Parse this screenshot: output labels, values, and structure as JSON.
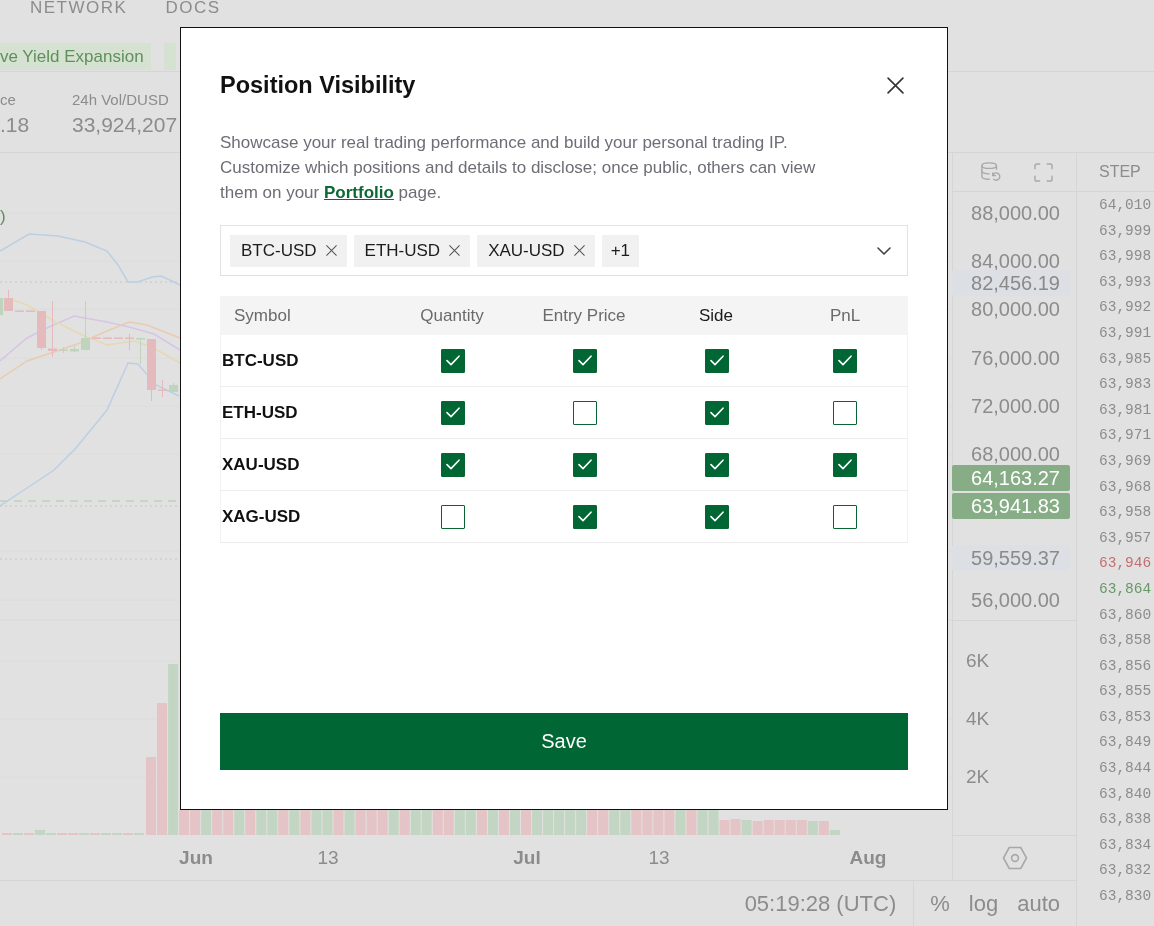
{
  "nav": {
    "items": [
      {
        "label": "NETWORK"
      },
      {
        "label": "DOCS"
      }
    ]
  },
  "announcements": [
    {
      "label": "ve Yield Expansion"
    }
  ],
  "market_stats": [
    {
      "label": "ce",
      "value": ".18"
    },
    {
      "label": "24h Vol/DUSD",
      "value": "33,924,207"
    }
  ],
  "chart": {
    "legend": ")",
    "time_axis": [
      {
        "label": "Jun",
        "kind": "month"
      },
      {
        "label": "13",
        "kind": "day"
      },
      {
        "label": "Jul",
        "kind": "month"
      },
      {
        "label": "13",
        "kind": "day"
      },
      {
        "label": "Aug",
        "kind": "month"
      }
    ]
  },
  "price_axis": {
    "labels": [
      {
        "text": "88,000.00",
        "kind": "tick"
      },
      {
        "text": "84,000.00",
        "kind": "tick"
      },
      {
        "text": "82,456.19",
        "kind": "marker",
        "color": "#dcdfe3"
      },
      {
        "text": "80,000.00",
        "kind": "tick"
      },
      {
        "text": "76,000.00",
        "kind": "tick"
      },
      {
        "text": "72,000.00",
        "kind": "tick"
      },
      {
        "text": "68,000.00",
        "kind": "tick"
      },
      {
        "text": "64,163.27",
        "kind": "marker",
        "color": "#86ad86"
      },
      {
        "text": "63,941.83",
        "kind": "marker",
        "color": "#86ad86"
      },
      {
        "text": "59,559.37",
        "kind": "marker",
        "color": "#dcdfe3"
      },
      {
        "text": "56,000.00",
        "kind": "tick"
      }
    ],
    "volume_labels": [
      "6K",
      "4K",
      "2K"
    ]
  },
  "bottom_bar": {
    "time": "05:19:28 (UTC)",
    "toggles": [
      {
        "label": "%"
      },
      {
        "label": "log"
      },
      {
        "label": "auto"
      }
    ]
  },
  "order_book": {
    "header": "STEP",
    "rows": [
      {
        "price": "64,010",
        "color": "#8c8c8c"
      },
      {
        "price": "63,999",
        "color": "#8c8c8c"
      },
      {
        "price": "63,998",
        "color": "#8c8c8c"
      },
      {
        "price": "63,993",
        "color": "#8c8c8c"
      },
      {
        "price": "63,992",
        "color": "#8c8c8c"
      },
      {
        "price": "63,991",
        "color": "#8c8c8c"
      },
      {
        "price": "63,985",
        "color": "#8c8c8c"
      },
      {
        "price": "63,983",
        "color": "#8c8c8c"
      },
      {
        "price": "63,981",
        "color": "#8c8c8c"
      },
      {
        "price": "63,971",
        "color": "#8c8c8c"
      },
      {
        "price": "63,969",
        "color": "#8c8c8c"
      },
      {
        "price": "63,968",
        "color": "#8c8c8c"
      },
      {
        "price": "63,958",
        "color": "#8c8c8c"
      },
      {
        "price": "63,957",
        "color": "#8c8c8c"
      },
      {
        "price": "63,946",
        "color": "#c46f6f"
      },
      {
        "price": "63,864",
        "color": "#669966"
      },
      {
        "price": "63,860",
        "color": "#8c8c8c"
      },
      {
        "price": "63,858",
        "color": "#8c8c8c"
      },
      {
        "price": "63,856",
        "color": "#8c8c8c"
      },
      {
        "price": "63,855",
        "color": "#8c8c8c"
      },
      {
        "price": "63,853",
        "color": "#8c8c8c"
      },
      {
        "price": "63,849",
        "color": "#8c8c8c"
      },
      {
        "price": "63,844",
        "color": "#8c8c8c"
      },
      {
        "price": "63,840",
        "color": "#8c8c8c"
      },
      {
        "price": "63,838",
        "color": "#8c8c8c"
      },
      {
        "price": "63,834",
        "color": "#8c8c8c"
      },
      {
        "price": "63,832",
        "color": "#8c8c8c"
      },
      {
        "price": "63,830",
        "color": "#8c8c8c"
      }
    ]
  },
  "dialog": {
    "title": "Position Visibility",
    "description": {
      "text": "Showcase your real trading performance and build your personal trading IP. Customize which positions and details to disclose; once public, others can view them on your",
      "link": "Portfolio",
      "after": "page."
    },
    "symbol_select": {
      "chips": [
        {
          "label": "BTC-USD",
          "kind": "symbol"
        },
        {
          "label": "ETH-USD",
          "kind": "symbol"
        },
        {
          "label": "XAU-USD",
          "kind": "symbol"
        },
        {
          "label": "+1",
          "kind": "overflow"
        }
      ]
    },
    "table": {
      "columns": [
        {
          "label": "Symbol",
          "emphasized": false
        },
        {
          "label": "Quantity",
          "emphasized": false
        },
        {
          "label": "Entry Price",
          "emphasized": false
        },
        {
          "label": "Side",
          "emphasized": true
        },
        {
          "label": "PnL",
          "emphasized": false
        }
      ],
      "rows": [
        {
          "symbol": "BTC-USD",
          "cells": [
            {
              "checked": true
            },
            {
              "checked": true
            },
            {
              "checked": true
            },
            {
              "checked": true
            }
          ]
        },
        {
          "symbol": "ETH-USD",
          "cells": [
            {
              "checked": true
            },
            {
              "checked": false
            },
            {
              "checked": true
            },
            {
              "checked": false
            }
          ]
        },
        {
          "symbol": "XAU-USD",
          "cells": [
            {
              "checked": true
            },
            {
              "checked": true
            },
            {
              "checked": true
            },
            {
              "checked": true
            }
          ]
        },
        {
          "symbol": "XAG-USD",
          "cells": [
            {
              "checked": false
            },
            {
              "checked": true
            },
            {
              "checked": true
            },
            {
              "checked": false
            }
          ]
        }
      ]
    },
    "save_button": {
      "label": "Save"
    }
  }
}
